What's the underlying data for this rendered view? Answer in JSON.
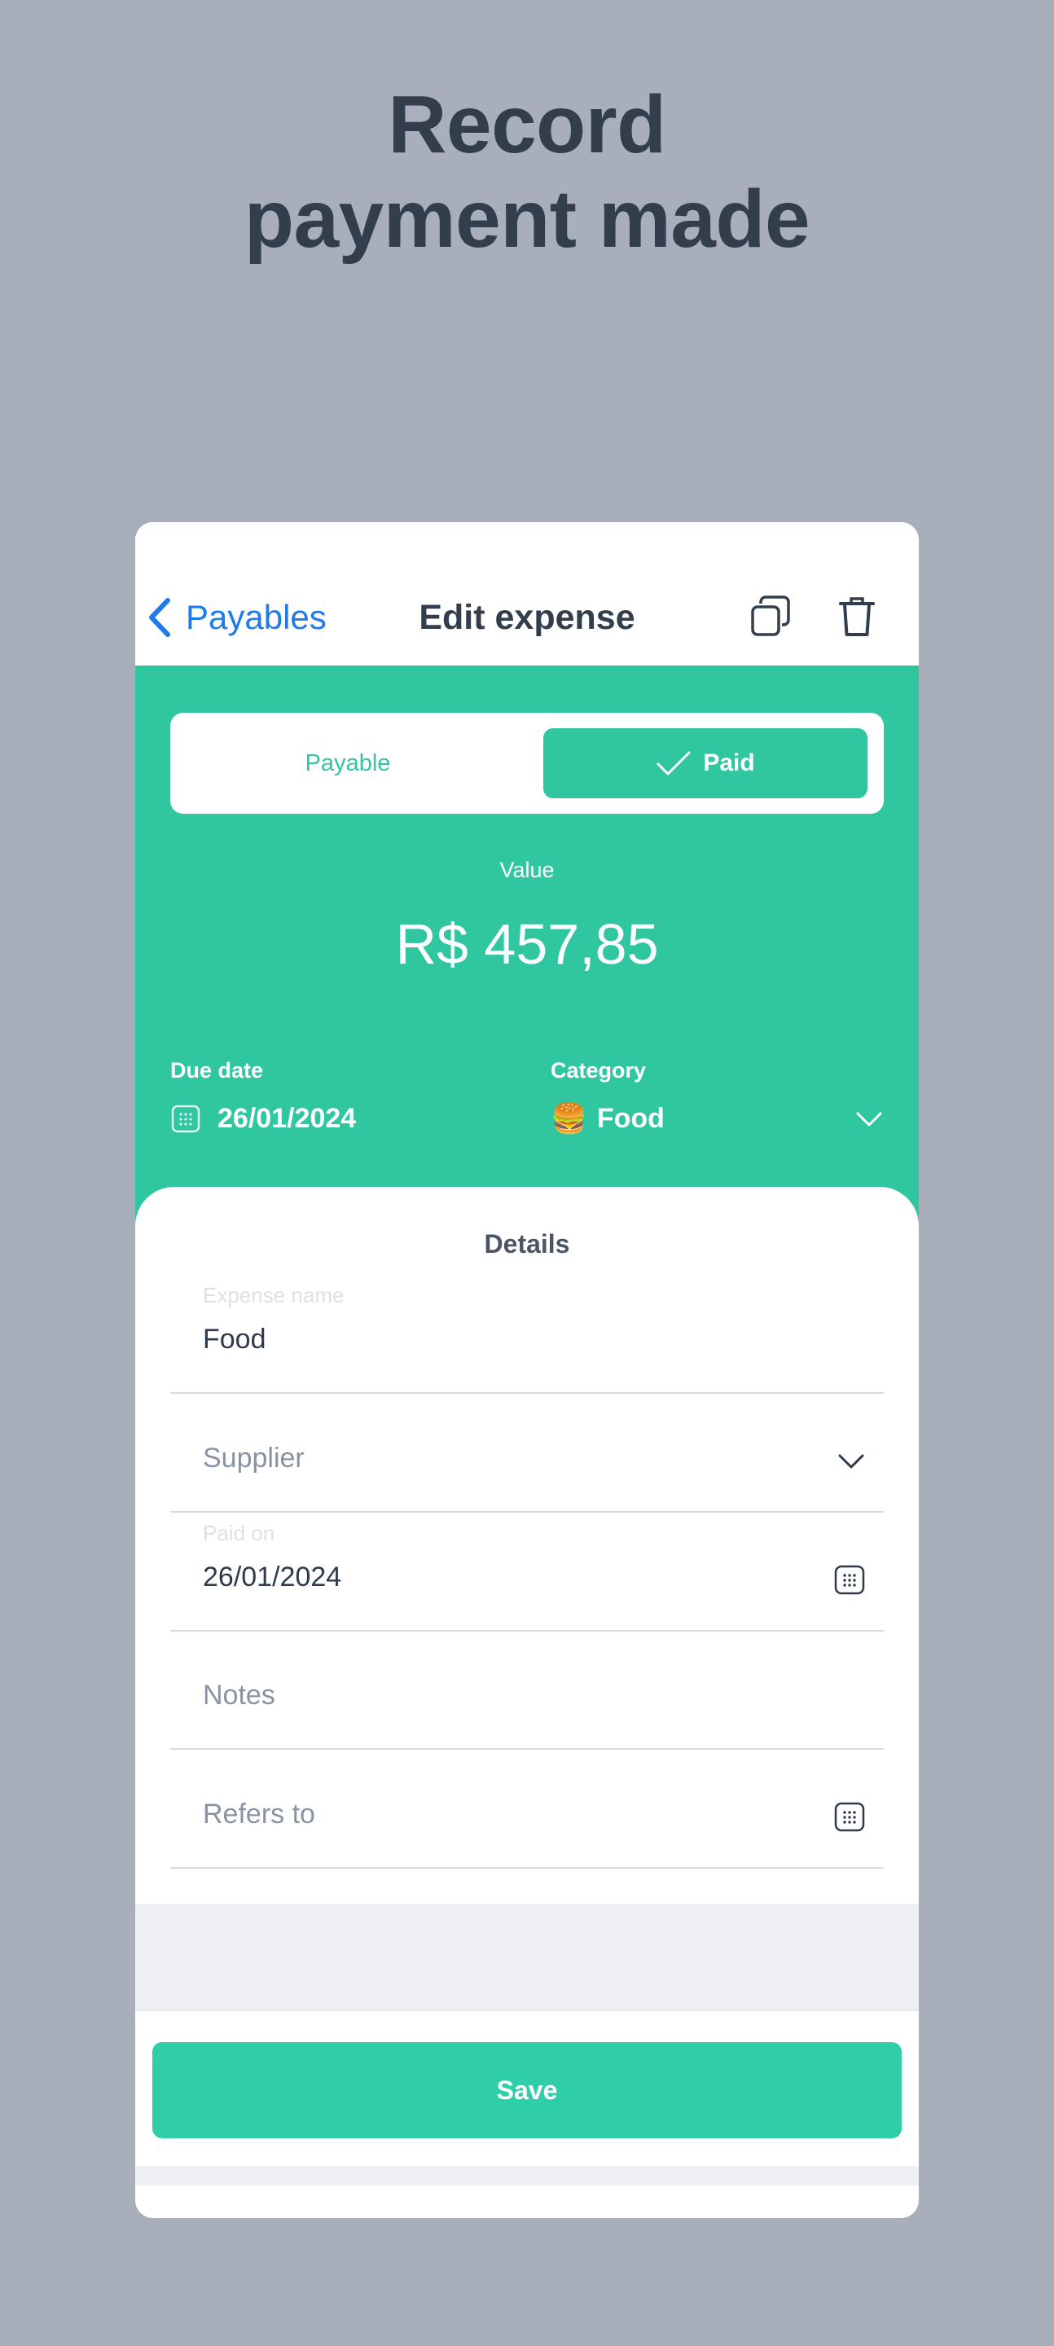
{
  "headline": "Record payment made",
  "nav": {
    "back_label": "Payables",
    "title": "Edit expense",
    "icons": [
      "chevron-left-icon",
      "copy-icon",
      "trash-icon"
    ]
  },
  "status_toggle": {
    "options": [
      "Payable",
      "Paid"
    ],
    "selected": "Paid"
  },
  "value": {
    "label": "Value",
    "amount": "R$ 457,85"
  },
  "due_date": {
    "label": "Due date",
    "value": "26/01/2024"
  },
  "category": {
    "label": "Category",
    "emoji": "🍔",
    "value": "Food"
  },
  "details": {
    "title": "Details",
    "expense_name": {
      "label": "Expense name",
      "value": "Food"
    },
    "supplier": {
      "placeholder": "Supplier"
    },
    "paid_on": {
      "label": "Paid on",
      "value": "26/01/2024"
    },
    "notes": {
      "placeholder": "Notes"
    },
    "refers_to": {
      "placeholder": "Refers to"
    }
  },
  "save_label": "Save",
  "colors": {
    "background": "#a8afbb",
    "accent_green": "#30c6a0",
    "save_green": "#2ecfa8",
    "link_blue": "#1f7bea",
    "text_dark": "#333e4c"
  }
}
